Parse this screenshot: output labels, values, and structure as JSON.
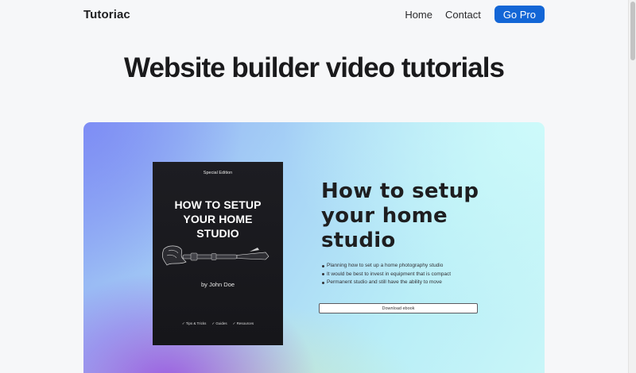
{
  "header": {
    "brand": "Tutoriac",
    "nav": [
      {
        "label": "Home"
      },
      {
        "label": "Contact"
      }
    ],
    "cta": "Go Pro"
  },
  "page": {
    "title": "Website builder video tutorials"
  },
  "hero": {
    "book": {
      "edition": "Special Edition",
      "title": "HOW TO SETUP YOUR HOME STUDIO",
      "author": "by John Doe",
      "tags": [
        "✓ Tips & Tricks",
        "✓ Guides",
        "✓ Resources"
      ]
    },
    "heading": "How to setup your home studio",
    "bullets": [
      "Planning how to set up a home photography studio",
      "It would be best to invest in equipment that is compact",
      "Permanent studio and still have the ability to move"
    ],
    "download_label": "Download ebook"
  },
  "colors": {
    "accent": "#1366d6",
    "book_bg": "#1b1b1f"
  }
}
